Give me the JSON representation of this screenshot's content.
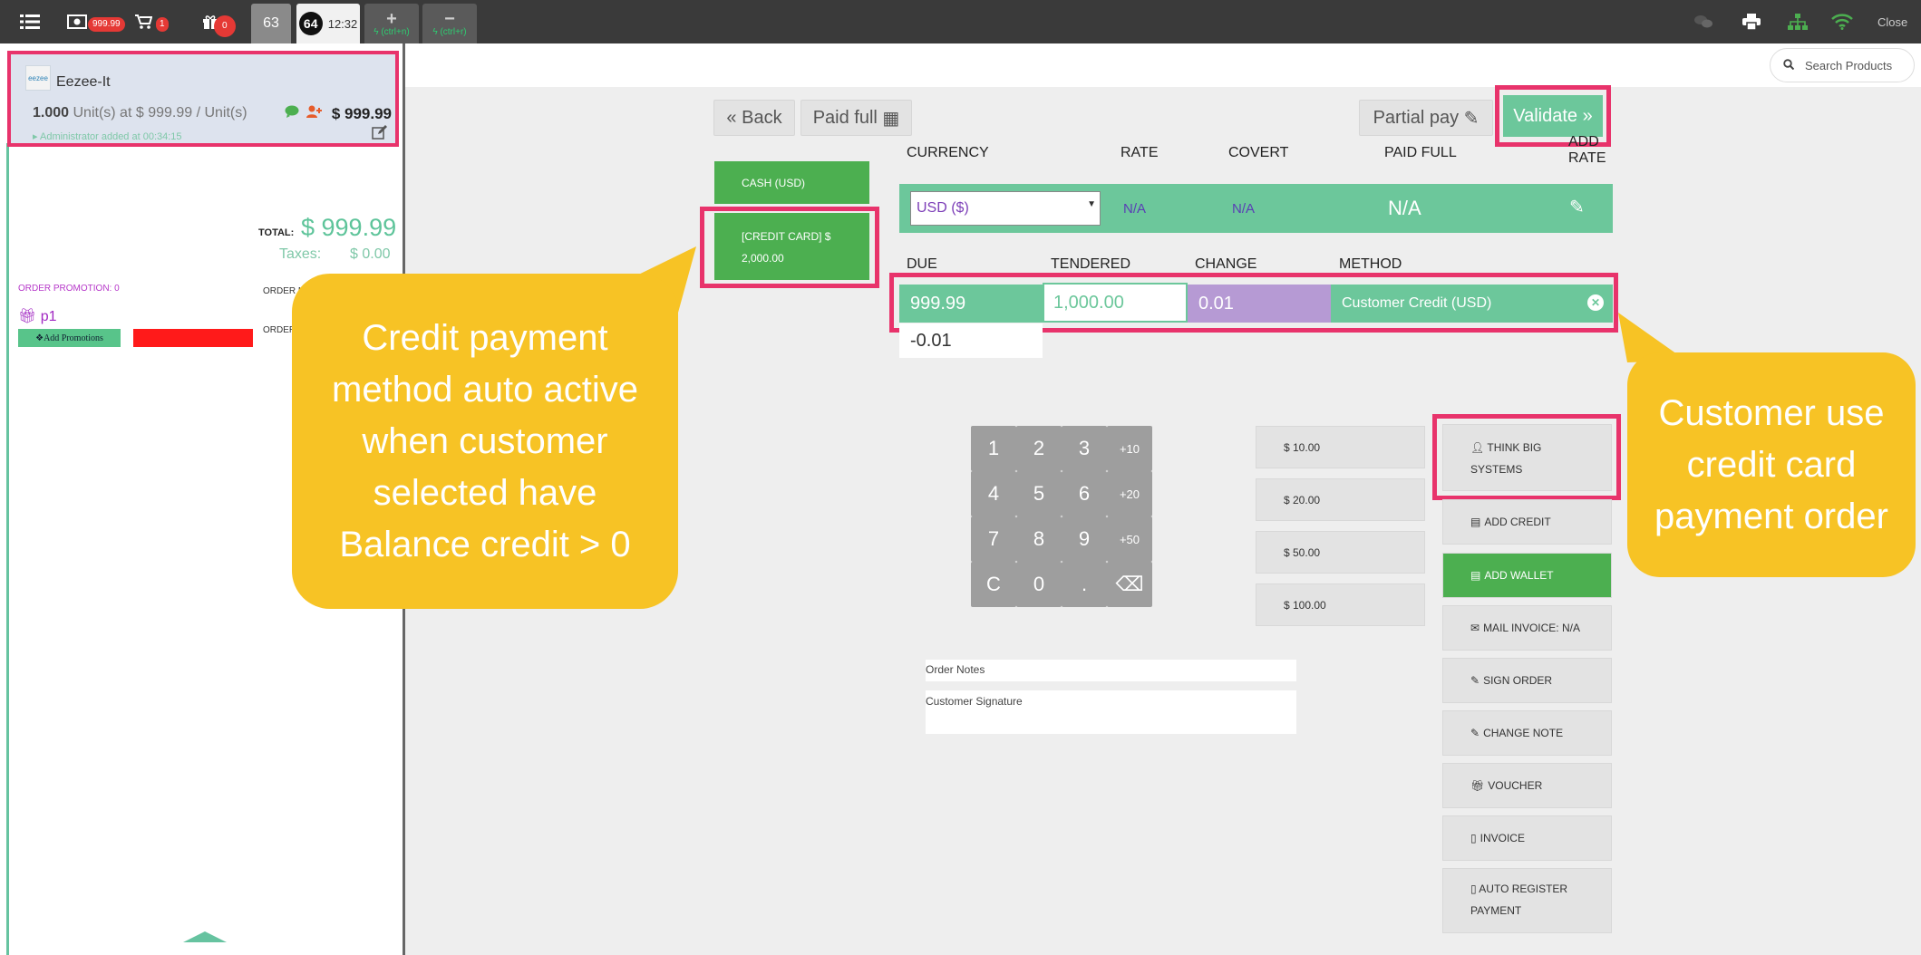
{
  "topbar": {
    "badge_cash": "999.99",
    "badge_cart": "1",
    "badge_gift": "0",
    "tab_63": "63",
    "tab_64_num": "64",
    "tab_64_time": "12:32",
    "add_shortcut": "(ctrl+n)",
    "remove_shortcut": "(ctrl+r)",
    "close_label": "Close"
  },
  "search": {
    "placeholder": "Search Products"
  },
  "order_line": {
    "product_name": "Eezee-It",
    "qty": "1.000",
    "qty_text": "Unit(s) at $ 999.99 / Unit(s)",
    "price": "$ 999.99",
    "admin_text": "Administrator added at 00:34:15"
  },
  "summary": {
    "total_label": "TOTAL:",
    "total_value": "$ 999.99",
    "taxes_label": "Taxes:",
    "taxes_value": "$ 0.00",
    "order_promotion": "ORDER PROMOTION: 0",
    "order_notes": "ORDER NOTES",
    "order_s": "ORDER S",
    "promo_item": "p1",
    "add_promotions": "Add Promotions"
  },
  "payment": {
    "back": "Back",
    "paid_full_btn": "Paid full",
    "partial_pay": "Partial pay",
    "validate": "Validate",
    "methods": [
      "CASH (USD)",
      "[CREDIT CARD] $ 2,000.00"
    ],
    "headers": {
      "currency": "CURRENCY",
      "rate": "RATE",
      "covert": "COVERT",
      "paid_full": "PAID FULL",
      "add_rate": "ADD RATE"
    },
    "currency_value": "USD ($)",
    "rate_value": "N/A",
    "covert_value": "N/A",
    "paid_full_value": "N/A",
    "line_headers": {
      "due": "DUE",
      "tendered": "TENDERED",
      "change": "CHANGE",
      "method": "METHOD"
    },
    "due": "999.99",
    "tendered": "1,000.00",
    "change": "0.01",
    "method": "Customer Credit (USD)",
    "remaining": "-0.01"
  },
  "keypad": {
    "keys": [
      "1",
      "2",
      "3",
      "+10",
      "4",
      "5",
      "6",
      "+20",
      "7",
      "8",
      "9",
      "+50",
      "C",
      "0",
      ".",
      "⌫"
    ]
  },
  "quick_amounts": [
    "$ 10.00",
    "$ 20.00",
    "$ 50.00",
    "$ 100.00"
  ],
  "actions": {
    "customer": "THINK BIG SYSTEMS",
    "add_credit": "ADD CREDIT",
    "add_wallet": "ADD WALLET",
    "mail_invoice": "MAIL INVOICE: N/A",
    "sign_order": "SIGN ORDER",
    "change_note": "CHANGE NOTE",
    "voucher": "VOUCHER",
    "invoice": "INVOICE",
    "auto_register": "AUTO REGISTER PAYMENT"
  },
  "fields": {
    "order_notes": "Order Notes",
    "customer_signature": "Customer Signature"
  },
  "callouts": {
    "left": "Credit payment method auto active when customer selected have Balance credit > 0",
    "right": "Customer use credit card payment order"
  },
  "colors": {
    "accent_green": "#6cc79b",
    "button_green": "#4caf50",
    "highlight": "#e8336b",
    "callout": "#f7c325"
  }
}
